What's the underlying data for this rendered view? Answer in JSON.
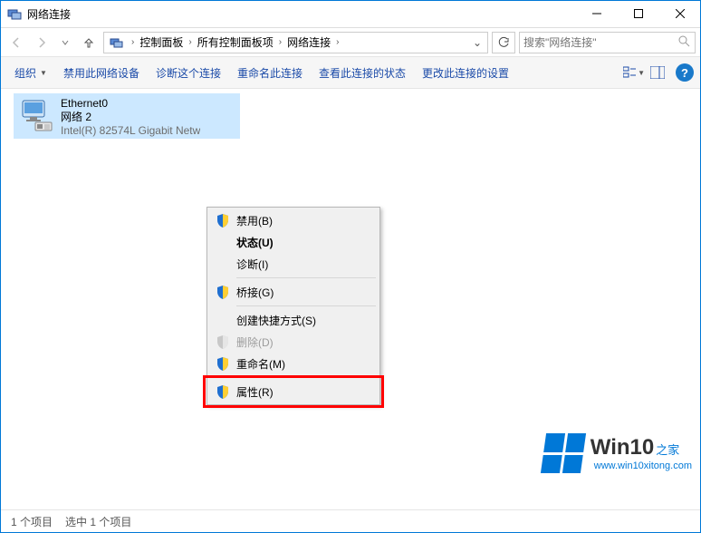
{
  "window": {
    "title": "网络连接"
  },
  "breadcrumb": {
    "items": [
      "控制面板",
      "所有控制面板项",
      "网络连接"
    ]
  },
  "search": {
    "placeholder": "搜索\"网络连接\""
  },
  "toolbar": {
    "organize": "组织",
    "disable": "禁用此网络设备",
    "diagnose": "诊断这个连接",
    "rename": "重命名此连接",
    "status": "查看此连接的状态",
    "settings": "更改此连接的设置"
  },
  "adapter": {
    "name": "Ethernet0",
    "status": "网络 2",
    "device": "Intel(R) 82574L Gigabit Netw"
  },
  "context_menu": {
    "disable": "禁用(B)",
    "status_bold": "状态(U)",
    "diagnose": "诊断(I)",
    "bridge": "桥接(G)",
    "shortcut": "创建快捷方式(S)",
    "delete": "删除(D)",
    "rename": "重命名(M)",
    "properties": "属性(R)"
  },
  "statusbar": {
    "count": "1 个项目",
    "selected": "选中 1 个项目"
  },
  "watermark": {
    "brand_main": "Win10",
    "brand_sub": "之家",
    "url": "www.win10xitong.com"
  }
}
